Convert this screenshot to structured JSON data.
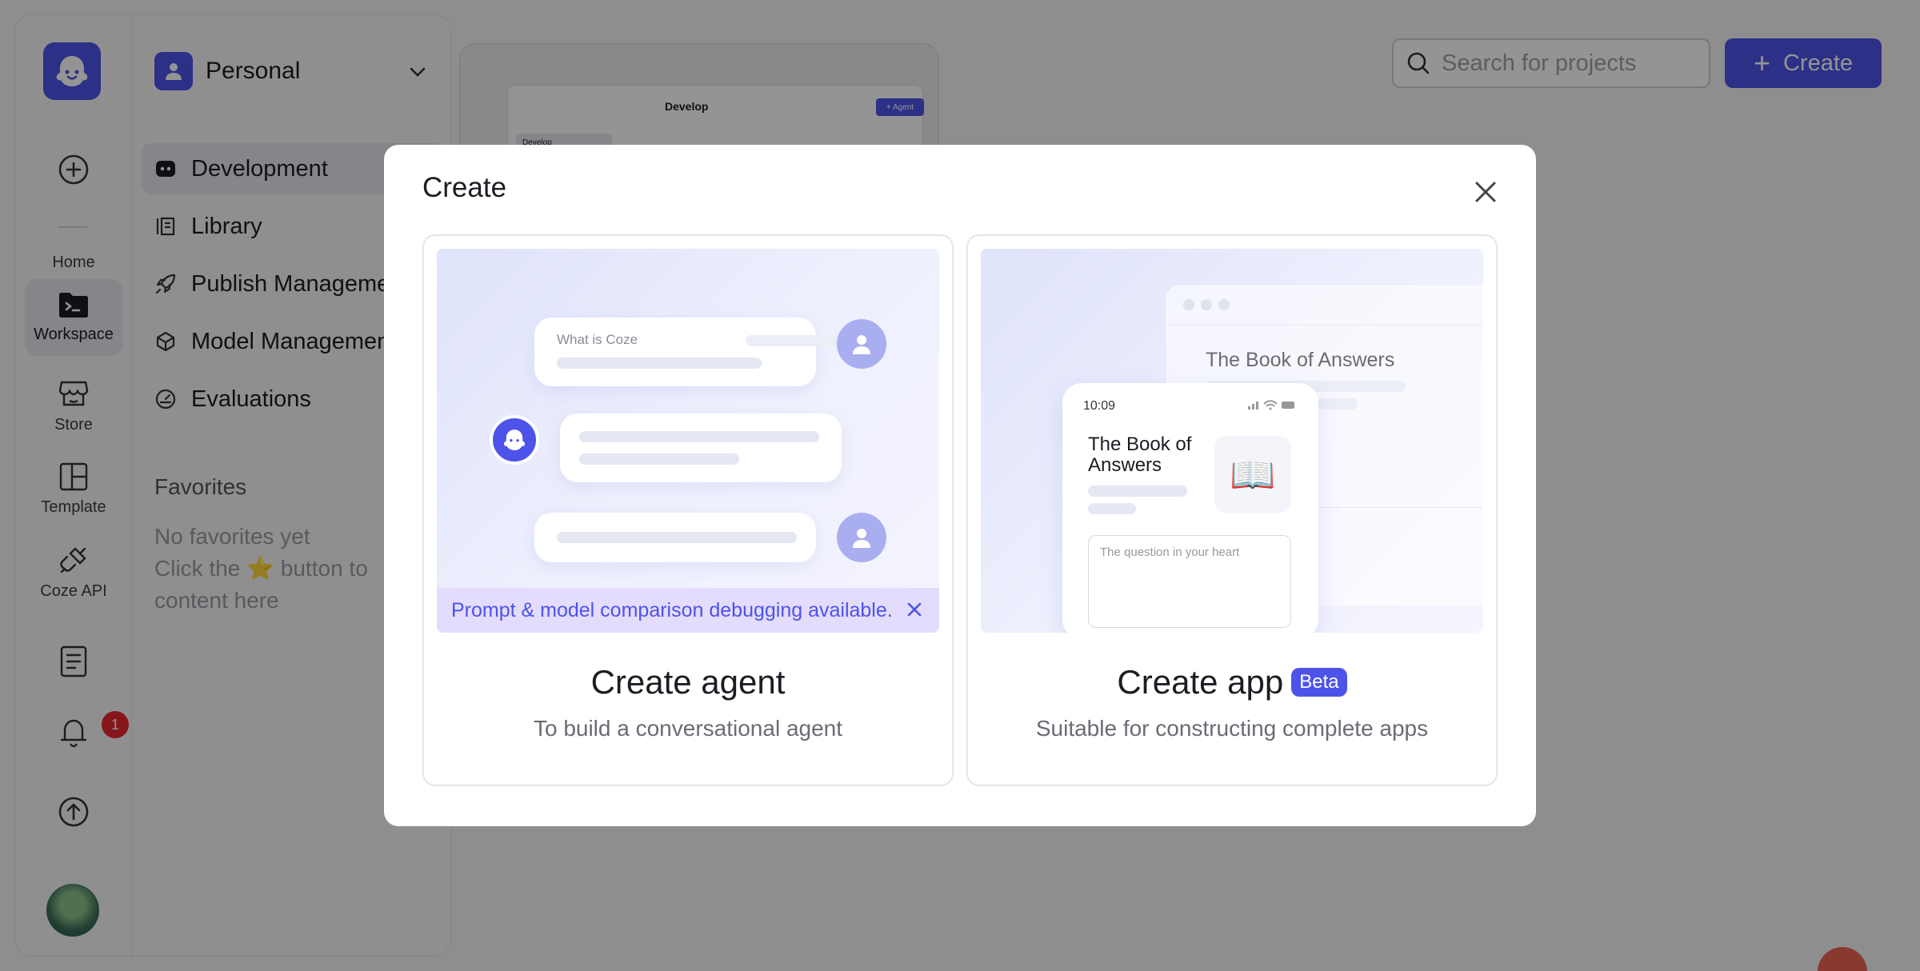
{
  "rail": {
    "home_label": "Home",
    "workspace_label": "Workspace",
    "store_label": "Store",
    "template_label": "Template",
    "api_label": "Coze API",
    "notification_count": "1"
  },
  "panel": {
    "workspace_name": "Personal",
    "nav": [
      "Development",
      "Library",
      "Publish Management",
      "Model Management",
      "Evaluations"
    ],
    "favorites_title": "Favorites",
    "favorites_empty_line1": "No favorites yet",
    "favorites_empty_line2": "Click the ⭐ button to",
    "favorites_empty_line3": "content here"
  },
  "main": {
    "search_placeholder": "Search for projects",
    "create_label": "Create",
    "thumb": {
      "title": "Develop",
      "button": "+ Agent",
      "side_item": "Develop"
    }
  },
  "modal": {
    "title": "Create",
    "agent_card": {
      "title": "Create agent",
      "subtitle": "To build a conversational agent",
      "chat_prompt": "What is Coze",
      "tip": "Prompt & model comparison debugging available."
    },
    "app_card": {
      "title": "Create app",
      "badge": "Beta",
      "subtitle": "Suitable for constructing complete apps",
      "window_title": "The Book of Answers",
      "phone_time": "10:09",
      "phone_title": "The Book of Answers",
      "book_emoji": "📖",
      "phone_input_placeholder": "The question in your heart"
    }
  },
  "colors": {
    "accent": "#4d53e8",
    "badge_red": "#e5262e"
  }
}
